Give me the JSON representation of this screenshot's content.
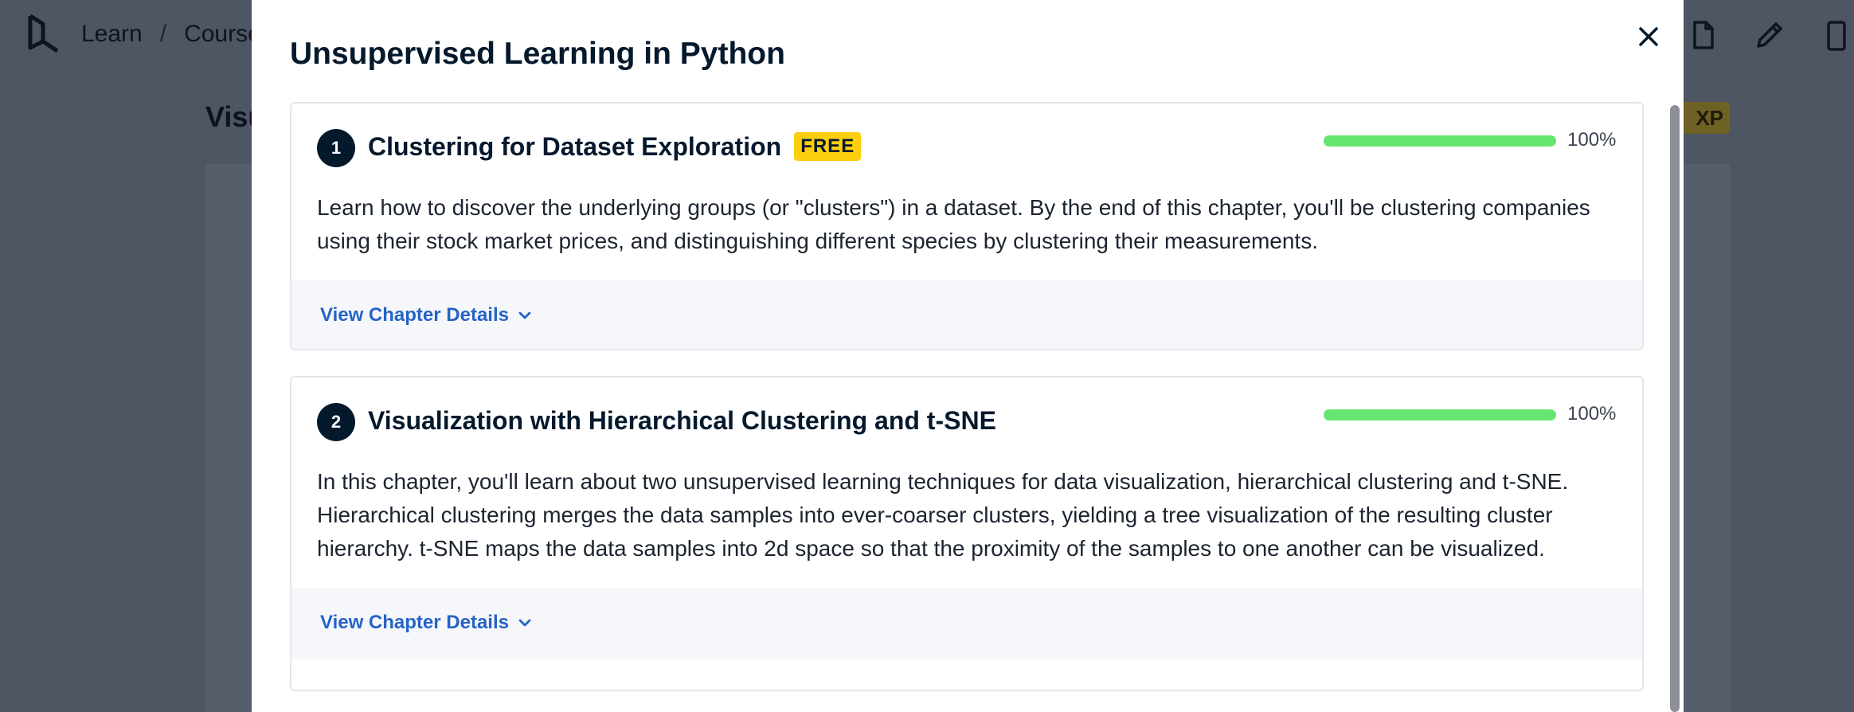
{
  "background": {
    "breadcrumb": [
      "Learn",
      "/",
      "Course"
    ],
    "title_fragment": "Visu",
    "xp_fragment": "XP"
  },
  "modal": {
    "title": "Unsupervised Learning in Python",
    "chapters": [
      {
        "number": "1",
        "title": "Clustering for Dataset Exploration",
        "badge": "FREE",
        "progress_percent": 100,
        "progress_label": "100%",
        "description": "Learn how to discover the underlying groups (or \"clusters\") in a dataset. By the end of this chapter, you'll be clustering companies using their stock market prices, and distinguishing different species by clustering their measurements.",
        "details_label": "View Chapter Details"
      },
      {
        "number": "2",
        "title": "Visualization with Hierarchical Clustering and t-SNE",
        "progress_percent": 100,
        "progress_label": "100%",
        "description": "In this chapter, you'll learn about two unsupervised learning techniques for data visualization, hierarchical clustering and t-SNE. Hierarchical clustering merges the data samples into ever-coarser clusters, yielding a tree visualization of the resulting cluster hierarchy. t-SNE maps the data samples into 2d space so that the proximity of the samples to one another can be visualized.",
        "details_label": "View Chapter Details"
      }
    ]
  },
  "colors": {
    "accent_link": "#2563c6",
    "progress_fill": "#66e570",
    "badge": "#fcce0d",
    "navy": "#05192d"
  }
}
